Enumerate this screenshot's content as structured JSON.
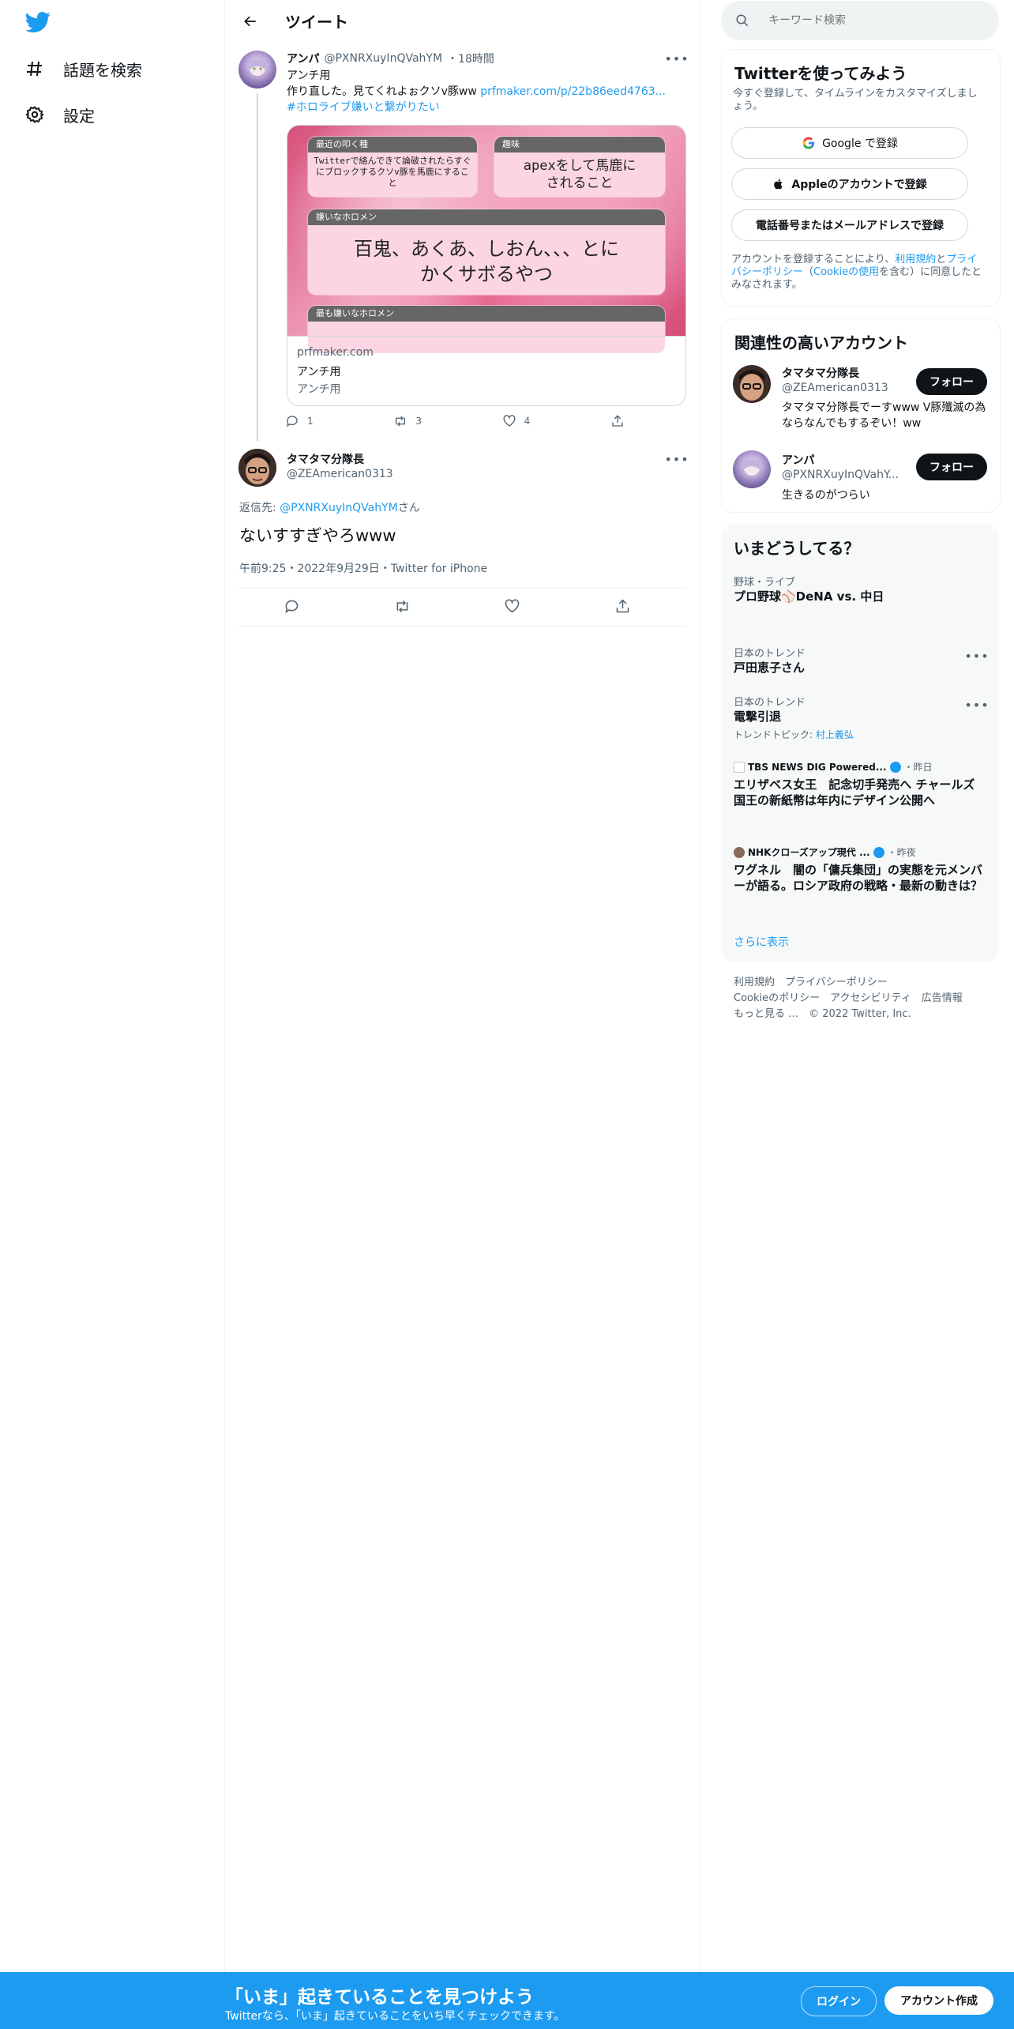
{
  "nav": {
    "items": [
      {
        "label": "話題を検索",
        "icon": "hashtag-icon"
      },
      {
        "label": "設定",
        "icon": "gear-icon"
      }
    ]
  },
  "header": {
    "title": "ツイート"
  },
  "tweet1": {
    "name": "アンパ",
    "handle": "@PXNRXuyInQVahYM",
    "time": "・18時間",
    "line1": "アンチ用",
    "line2_text": "作り直した。見てくれよぉクソv豚ww ",
    "line2_link": "prfmaker.com/p/22b86eed4763...",
    "hashtag": "#ホロライブ嫌いと繋がりたい",
    "card": {
      "box1_label": "最近の叩く種",
      "box1_value": "Twitterで絡んできて論破されたらすぐにブロックするクソv豚を馬鹿にすること",
      "box2_label": "趣味",
      "box2_value": "apexをして馬鹿にされること",
      "box3_label": "嫌いなホロメン",
      "box3_value": "百鬼、あくあ、しおん、、、とにかくサボるやつ",
      "box4_label": "最も嫌いなホロメン",
      "domain": "prfmaker.com",
      "title": "アンチ用",
      "desc": "アンチ用"
    },
    "replies": "1",
    "retweets": "3",
    "likes": "4"
  },
  "tweet2": {
    "name": "タマタマ分隊長",
    "handle": "@ZEAmerican0313",
    "reply_prefix": "返信先: ",
    "reply_handle": "@PXNRXuyInQVahYM",
    "reply_suffix": "さん",
    "text": "ないすすぎやろwww",
    "meta": "午前9:25・2022年9月29日・Twitter for iPhone"
  },
  "search": {
    "placeholder": "キーワード検索"
  },
  "signup": {
    "title": "Twitterを使ってみよう",
    "subtitle": "今すぐ登録して、タイムラインをカスタマイズしましょう。",
    "google": "Google で登録",
    "apple": "Appleのアカウントで登録",
    "phone": "電話番号またはメールアドレスで登録",
    "terms_prefix": "アカウントを登録することにより、",
    "terms_link": "利用規約",
    "terms_mid": "と",
    "privacy_link": "プライバシーポリシー",
    "paren_open": "（",
    "cookie_link": "Cookieの使用",
    "terms_suffix": "を含む）に同意したとみなされます。"
  },
  "related": {
    "title": "関連性の高いアカウント",
    "accounts": [
      {
        "name": "タマタマ分隊長",
        "handle": "@ZEAmerican0313",
        "bio": "タマタマ分隊長でーすwww V豚殲滅の為ならなんでもするぞい！ww",
        "button": "フォロー"
      },
      {
        "name": "アンパ",
        "handle": "@PXNRXuyInQVahY...",
        "bio": "生きるのがつらい",
        "button": "フォロー"
      }
    ]
  },
  "trends": {
    "title": "いまどうしてる？",
    "items": [
      {
        "cat": "野球・ライブ",
        "title": "プロ野球⚾DeNA vs. 中日"
      },
      {
        "cat": "日本のトレンド",
        "title": "戸田恵子さん"
      },
      {
        "cat": "日本のトレンド",
        "title": "電撃引退",
        "sub_prefix": "トレンドトピック: ",
        "sub_link": "村上義弘"
      },
      {
        "cat": "TBS NEWS DIG Powered...",
        "time": "・昨日",
        "title": "エリザベス女王　記念切手発売へ チャールズ国王の新紙幣は年内にデザイン公開へ"
      },
      {
        "cat": "NHKクローズアップ現代 ...",
        "time": "・昨夜",
        "title": "ワグネル　闇の「傭兵集団」の実態を元メンバーが語る。ロシア政府の戦略・最新の動きは？"
      }
    ],
    "more": "さらに表示"
  },
  "footer": {
    "line1": "利用規約　プライバシーポリシー",
    "line2": "Cookieのポリシー　アクセシビリティ　広告情報",
    "line3": "もっと見る …　© 2022 Twitter, Inc."
  },
  "bottom": {
    "headline": "「いま」起きていることを見つけよう",
    "sub": "Twitterなら、「いま」起きていることをいち早くチェックできます。",
    "login": "ログイン",
    "signup": "アカウント作成"
  },
  "colors": {
    "accent": "#1d9bf0",
    "text": "#0f1419",
    "muted": "#536471"
  }
}
